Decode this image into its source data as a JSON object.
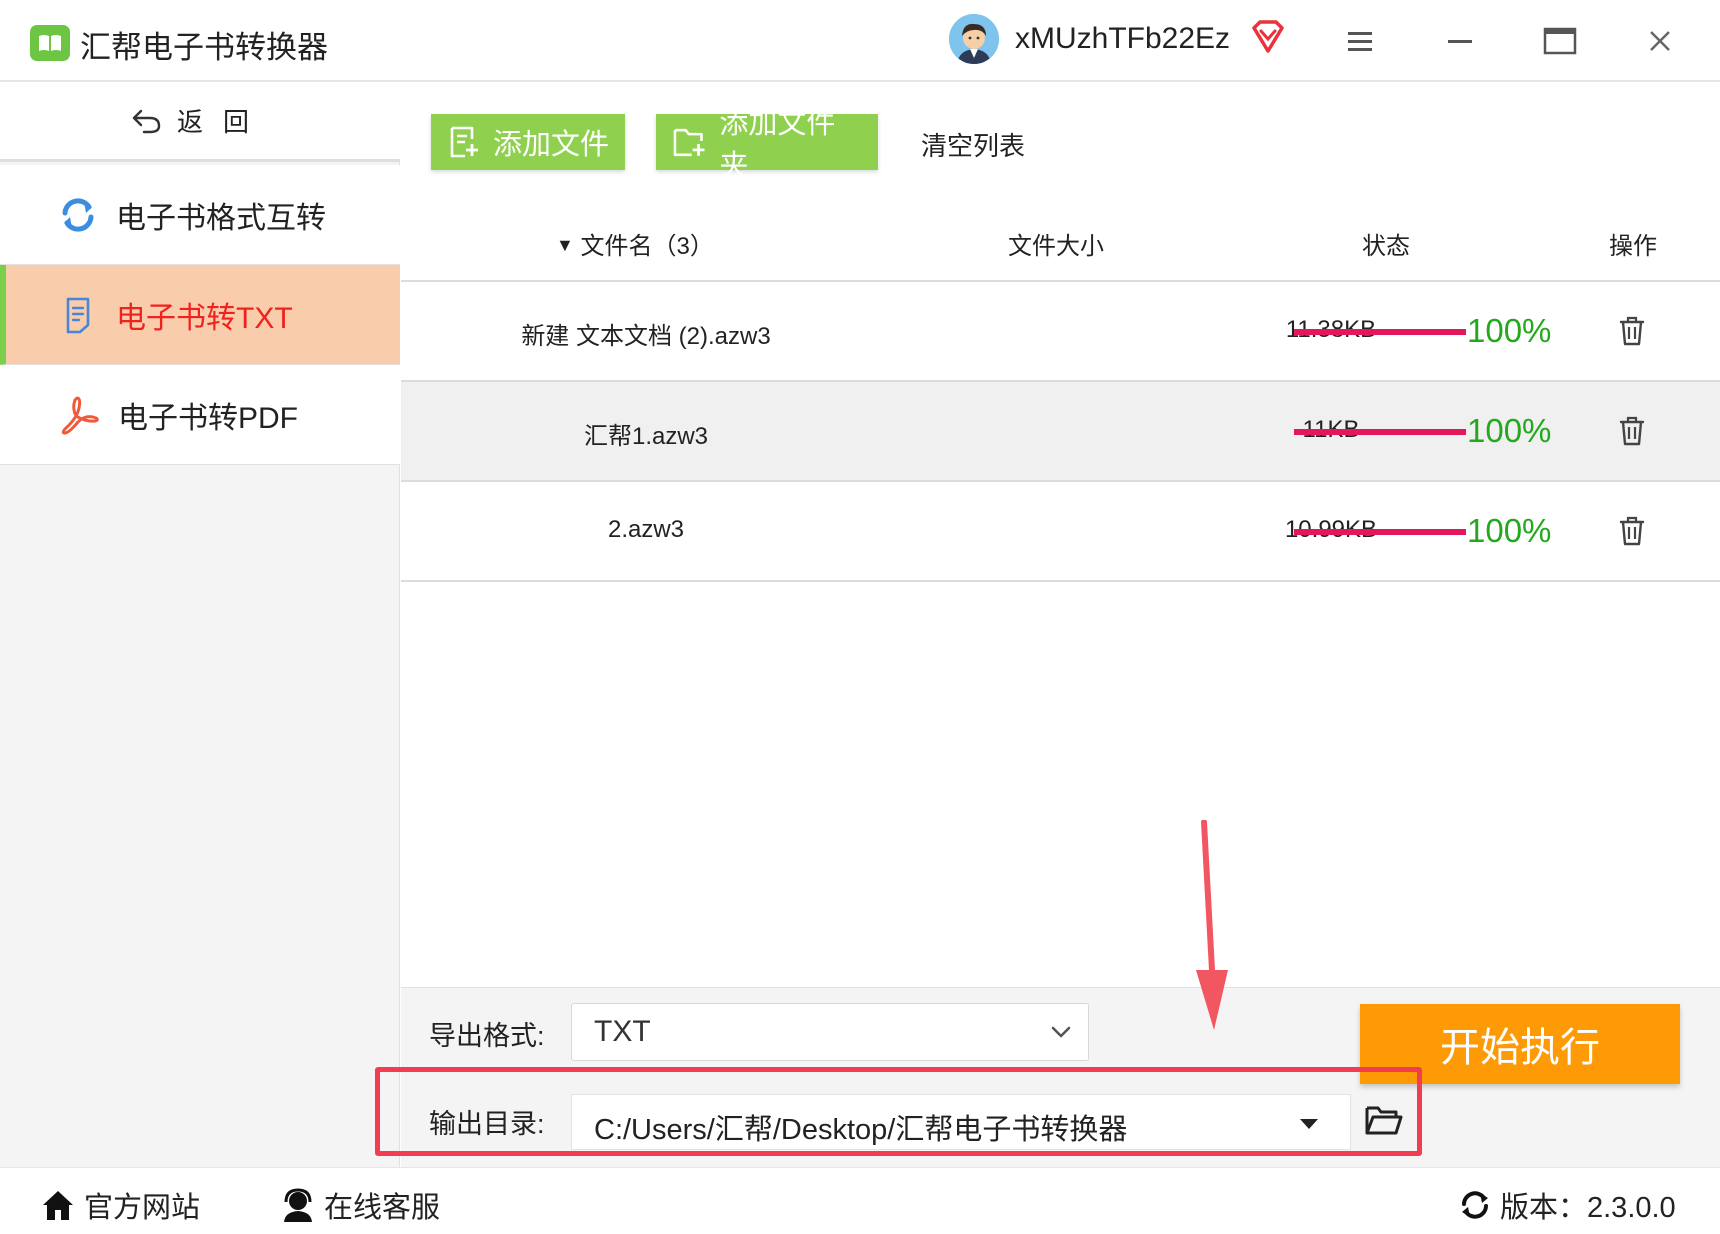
{
  "app": {
    "title": "汇帮电子书转换器",
    "username": "xMUzhTFb22Ez",
    "brand_color": "#6cc644"
  },
  "sidebar": {
    "back_label": "返回",
    "items": [
      {
        "label": "电子书格式互转",
        "icon": "refresh-icon",
        "active": false
      },
      {
        "label": "电子书转TXT",
        "icon": "document-icon",
        "active": true
      },
      {
        "label": "电子书转PDF",
        "icon": "pdf-icon",
        "active": false
      }
    ]
  },
  "toolbar": {
    "add_file": "添加文件",
    "add_folder": "添加文件夹",
    "clear_list": "清空列表"
  },
  "table": {
    "headers": {
      "name": "文件名（3）",
      "size": "文件大小",
      "status": "状态",
      "action": "操作"
    },
    "rows": [
      {
        "name": "新建 文本文档 (2).azw3",
        "size": "11.38KB",
        "progress": 100,
        "status": "100%"
      },
      {
        "name": "汇帮1.azw3",
        "size": "11KB",
        "progress": 100,
        "status": "100%"
      },
      {
        "name": "2.azw3",
        "size": "10.99KB",
        "progress": 100,
        "status": "100%"
      }
    ]
  },
  "export": {
    "format_label": "导出格式:",
    "format_value": "TXT",
    "dir_label": "输出目录:",
    "dir_value": "C:/Users/汇帮/Desktop/汇帮电子书转换器",
    "start_label": "开始执行"
  },
  "footer": {
    "website": "官方网站",
    "support": "在线客服",
    "version": "版本：2.3.0.0"
  },
  "colors": {
    "accent_green": "#8fd04f",
    "start_orange": "#fd9a06",
    "active_bg": "#f9ccab",
    "active_text": "#f0221e",
    "progress": "#e2185b",
    "percent_text": "#23a81e",
    "highlight_red": "#f23d51"
  }
}
